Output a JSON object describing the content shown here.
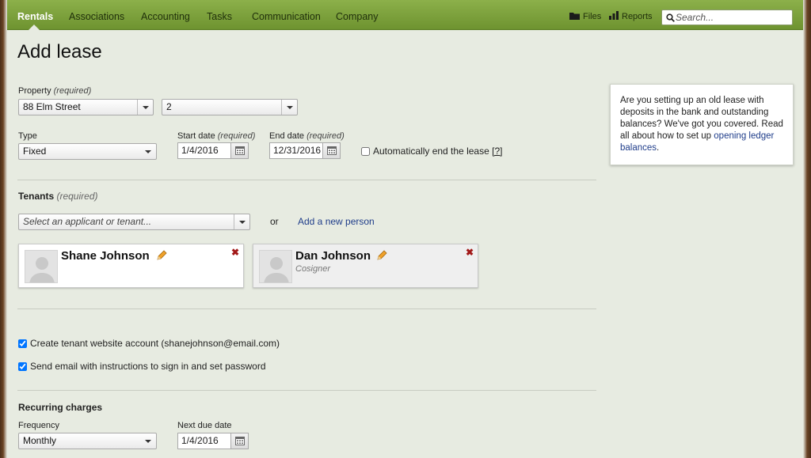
{
  "nav": {
    "items": [
      "Rentals",
      "Associations",
      "Accounting",
      "Tasks",
      "Communication",
      "Company"
    ],
    "files_label": "Files",
    "reports_label": "Reports",
    "search_placeholder": "Search..."
  },
  "title": "Add lease",
  "property": {
    "label": "Property",
    "required": "(required)",
    "property_value": "88 Elm Street",
    "unit_value": "2"
  },
  "type": {
    "label": "Type",
    "value": "Fixed"
  },
  "start_date": {
    "label": "Start date",
    "required": "(required)",
    "value": "1/4/2016"
  },
  "end_date": {
    "label": "End date",
    "required": "(required)",
    "value": "12/31/2016"
  },
  "auto_end": {
    "label": "Automatically end the lease",
    "help": "[?]",
    "checked": false
  },
  "tenants": {
    "label": "Tenants",
    "required": "(required)",
    "select_placeholder": "Select an applicant or tenant...",
    "or_text": "or",
    "add_link": "Add a new person",
    "cards": [
      {
        "name": "Shane Johnson",
        "role": ""
      },
      {
        "name": "Dan Johnson",
        "role": "Cosigner"
      }
    ]
  },
  "options": {
    "create_account": "Create tenant website account (shanejohnson@email.com)",
    "send_email": "Send email with instructions to sign in and set password"
  },
  "recurring": {
    "heading": "Recurring charges",
    "frequency_label": "Frequency",
    "frequency_value": "Monthly",
    "next_due_label": "Next due date",
    "next_due_value": "1/4/2016"
  },
  "info": {
    "text": "Are you setting up an old lease with deposits in the bank and outstanding balances? We've got you covered. Read all about how to set up ",
    "link": "opening ledger balances",
    "suffix": "."
  },
  "colors": {
    "nav_green": "#7aa13a",
    "link_blue": "#1f3d8a",
    "remove_red": "#a21818"
  }
}
